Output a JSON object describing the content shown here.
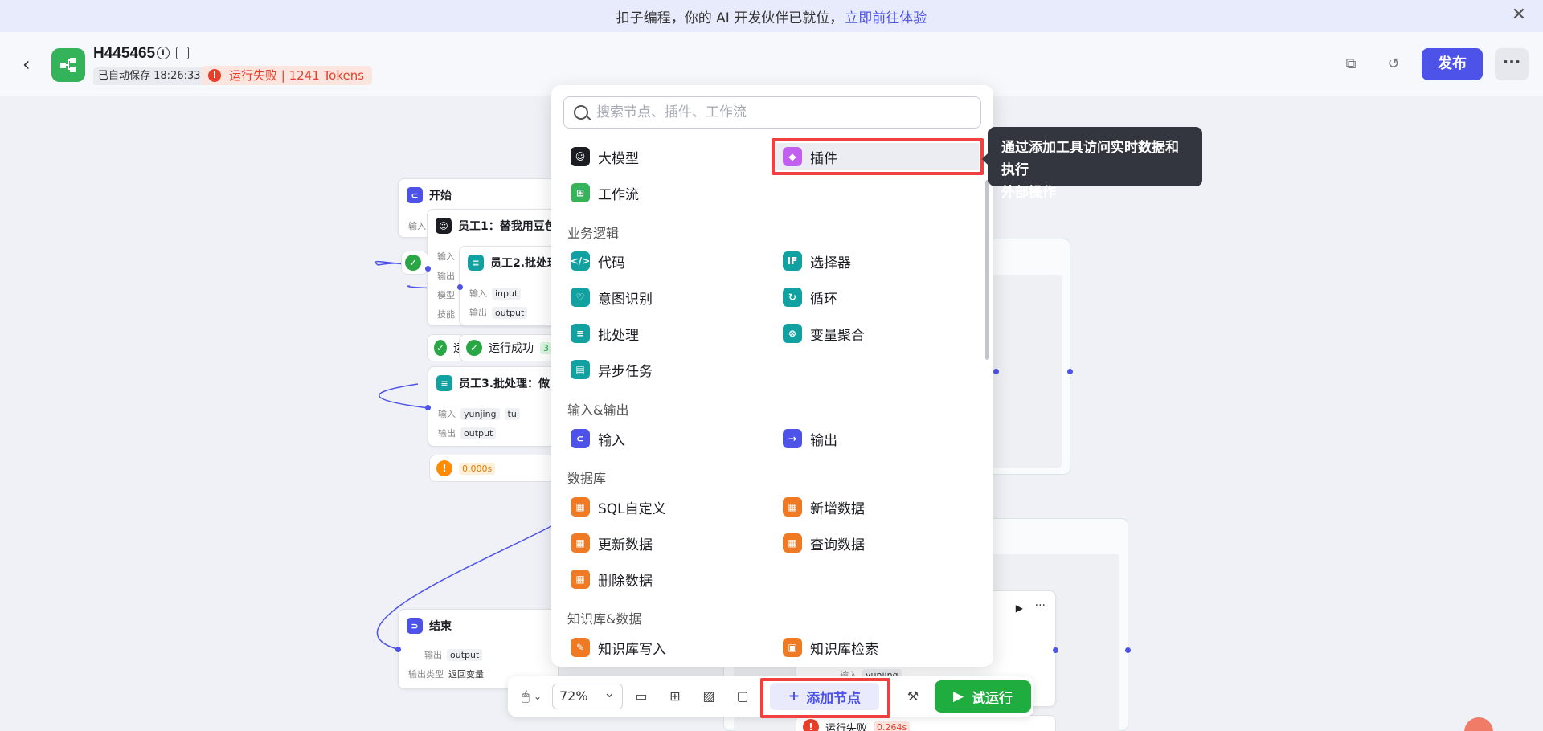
{
  "banner": {
    "text": "扣子编程，你的 AI 开发伙伴已就位，",
    "link": "立即前往体验",
    "close": "✕"
  },
  "header": {
    "title": "H445465",
    "autosave": "已自动保存 18:26:33",
    "run_status": "运行失败 | 1241 Tokens",
    "publish": "发布",
    "more": "···"
  },
  "canvas": {
    "start_node": {
      "title": "开始",
      "input_label": "输入"
    },
    "employee1": {
      "title": "员工1：替我用豆包",
      "rows": [
        "输入",
        "输出",
        "模型",
        "技能"
      ]
    },
    "employee2": {
      "title": "员工2.批处理",
      "input_label": "输入",
      "input_var": "input",
      "output_label": "输出",
      "output_var": "output"
    },
    "status_ok_1": "运行成功",
    "status_ok_2": "运",
    "status_ok_badge": "3",
    "employee3": {
      "title": "员工3.批处理：做",
      "input_label": "输入",
      "input_vars": [
        "yunjing",
        "tu"
      ],
      "output_label": "输出",
      "output_var": "output"
    },
    "warn_time": "0.000s",
    "end_node": {
      "title": "结束",
      "output_label": "输出",
      "output_var": "output",
      "output_type_label": "输出类型",
      "output_type_value": "返回变量"
    },
    "right_node": {
      "input_label": "输入",
      "input_var": "yunjing",
      "fail_text": "运行失败",
      "fail_time": "0.264s"
    }
  },
  "panel": {
    "search_placeholder": "搜索节点、插件、工作流",
    "top_items": [
      {
        "label": "大模型",
        "icon": "llm-icon",
        "color": "#1c1d23"
      },
      {
        "label": "插件",
        "icon": "plugin-icon",
        "color": "#c15ff0"
      },
      {
        "label": "工作流",
        "icon": "workflow-icon",
        "color": "#34b35a"
      }
    ],
    "sections": {
      "logic": "业务逻辑",
      "io": "输入&输出",
      "db": "数据库",
      "kb": "知识库&数据"
    },
    "logic_items": [
      "代码",
      "选择器",
      "意图识别",
      "循环",
      "批处理",
      "变量聚合",
      "异步任务"
    ],
    "io_items": [
      "输入",
      "输出"
    ],
    "db_items": [
      "SQL自定义",
      "新增数据",
      "更新数据",
      "查询数据",
      "删除数据"
    ],
    "kb_items": [
      "知识库写入",
      "知识库检索"
    ]
  },
  "tooltip": {
    "line1": "通过添加工具访问实时数据和执行",
    "line2": "外部操作"
  },
  "toolbar": {
    "zoom": "72%",
    "add_node": "添加节点",
    "test_run": "试运行"
  },
  "colors": {
    "accent": "#4d53e8",
    "teal": "#12a1a1",
    "orange": "#f07a24",
    "success": "#1fad40",
    "danger": "#e5402b"
  }
}
